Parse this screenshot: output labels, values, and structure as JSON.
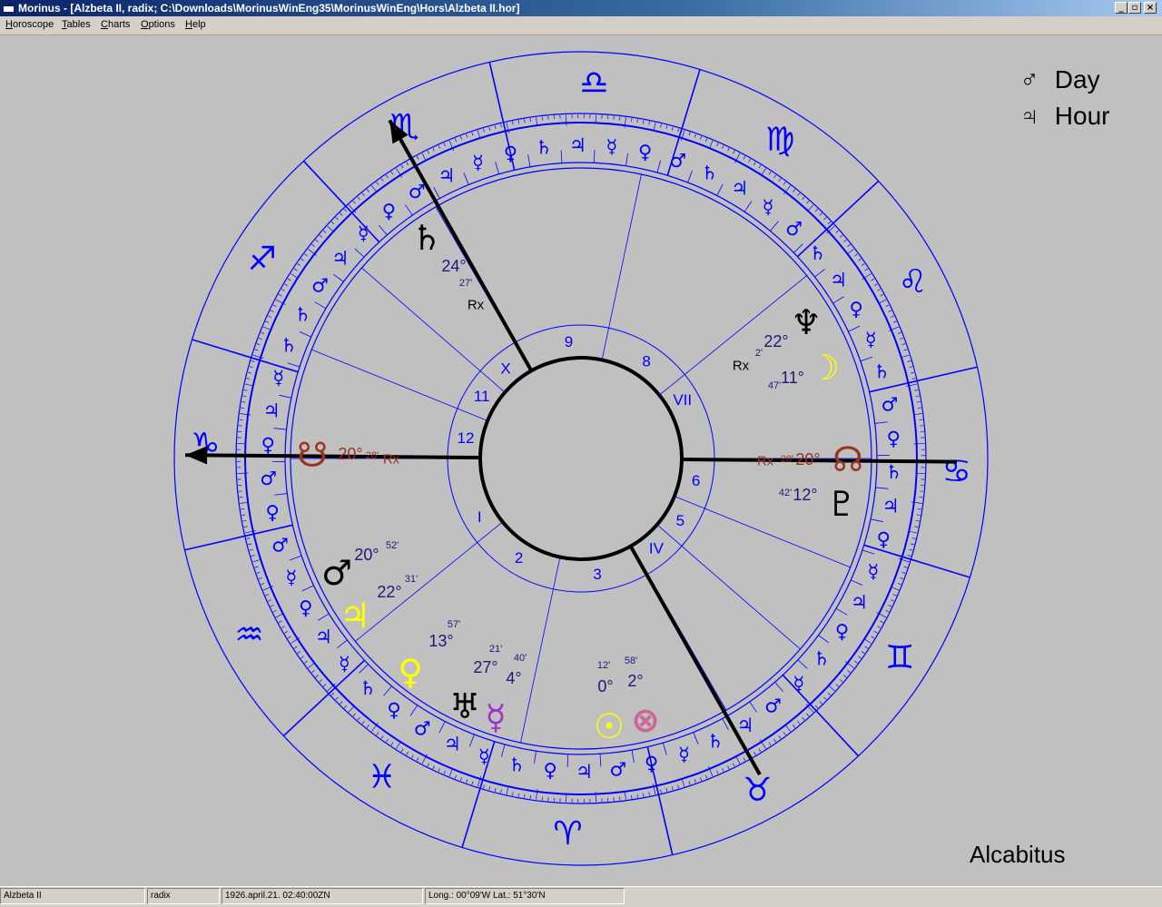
{
  "window": {
    "title": "Morinus - [Alzbeta II, radix; C:\\Downloads\\MorinusWinEng35\\MorinusWinEng\\Hors\\Alzbeta II.hor]"
  },
  "menu": [
    "Horoscope",
    "Tables",
    "Charts",
    "Options",
    "Help"
  ],
  "window_buttons": {
    "minimize": "_",
    "restore": "▫",
    "close": "×"
  },
  "day_hour": {
    "day_label": "Day",
    "day_symbol": "♂",
    "hour_label": "Hour",
    "hour_symbol": "♃"
  },
  "house_system": "Alcabitus",
  "chart": {
    "colors": {
      "ring": "#0000ff",
      "axis": "#000000",
      "node": "#993322",
      "sun": "#ffff00",
      "fortune": "#cc6699",
      "mercury": "#9933cc"
    },
    "signs": [
      "♑",
      "♐",
      "♏",
      "♎",
      "♍",
      "♌",
      "♋",
      "♊",
      "♉",
      "♈",
      "♓",
      "♒"
    ],
    "inner_houses": [
      "9",
      "8",
      "VII",
      "6",
      "5",
      "IV",
      "3",
      "2",
      "I",
      "12",
      "11",
      "X"
    ],
    "rulers": [
      "♀",
      "♂",
      "♀",
      "♃",
      "☿",
      "♄",
      "♄",
      "♂",
      "♃",
      "☿",
      "♀",
      "♂",
      "♃",
      "☿",
      "♀",
      "♄",
      "♃",
      "☿",
      "♀",
      "♂",
      "♄",
      "♃",
      "☿",
      "♂",
      "♄",
      "♃",
      "♀",
      "☿",
      "♄",
      "♂",
      "♀",
      "♄",
      "♃",
      "♀",
      "☿",
      "♃",
      "♀",
      "♄",
      "☿",
      "♂",
      "♃",
      "♄",
      "☿",
      "♀",
      "♂",
      "♃",
      "♀",
      "♄",
      "☿",
      "♃",
      "♂",
      "♀",
      "♄",
      "☿",
      "♃",
      "♀",
      "☿",
      "♂"
    ],
    "planets": [
      {
        "name": "saturn",
        "glyph": "♄",
        "deg": "24°",
        "min": "27'",
        "retro": "Rx",
        "color": "#000000"
      },
      {
        "name": "neptune",
        "glyph": "♆",
        "deg": "22°",
        "min": "2'",
        "retro": "Rx",
        "color": "#000000"
      },
      {
        "name": "moon",
        "glyph": "☽",
        "deg": "11°",
        "min": "47'",
        "retro": "",
        "color": "#ffff00"
      },
      {
        "name": "south-node",
        "glyph": "☋",
        "deg": "20°",
        "min": "28'",
        "retro": "Rx",
        "color": "#993322"
      },
      {
        "name": "north-node",
        "glyph": "☊",
        "deg": "20°",
        "min": "28'",
        "retro": "Rx",
        "color": "#993322"
      },
      {
        "name": "pluto",
        "glyph": "♇",
        "deg": "12°",
        "min": "42'",
        "retro": "",
        "color": "#000000"
      },
      {
        "name": "mars",
        "glyph": "♂",
        "deg": "20°",
        "min": "52'",
        "retro": "",
        "color": "#000000"
      },
      {
        "name": "jupiter",
        "glyph": "♃",
        "deg": "22°",
        "min": "31'",
        "retro": "",
        "color": "#ffff00"
      },
      {
        "name": "venus",
        "glyph": "♀",
        "deg": "13°",
        "min": "57'",
        "retro": "",
        "color": "#ffff00"
      },
      {
        "name": "uranus",
        "glyph": "♅",
        "deg": "27°",
        "min": "21'",
        "retro": "",
        "color": "#000000"
      },
      {
        "name": "mercury",
        "glyph": "☿",
        "deg": "4°",
        "min": "40'",
        "retro": "",
        "color": "#9933cc"
      },
      {
        "name": "sun",
        "glyph": "☉",
        "deg": "0°",
        "min": "12'",
        "retro": "",
        "color": "#ffff00"
      },
      {
        "name": "fortune",
        "glyph": "⊗",
        "deg": "2°",
        "min": "58'",
        "retro": "",
        "color": "#cc6699"
      }
    ]
  },
  "status": {
    "name": "Alzbeta II",
    "type": "radix",
    "datetime": "1926.april.21. 02:40:00ZN",
    "location": "Long.: 00°09'W Lat.: 51°30'N"
  }
}
